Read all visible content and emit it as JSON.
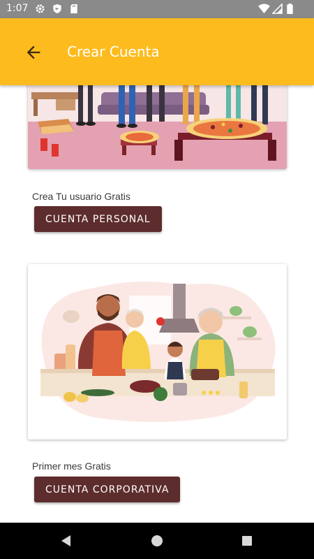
{
  "status_bar": {
    "time": "1:07",
    "icons": [
      "gear-icon",
      "shield-icon",
      "sd-card-icon",
      "wifi-icon",
      "signal-icon",
      "battery-icon"
    ]
  },
  "app_bar": {
    "title": "Crear Cuenta",
    "back_icon": "arrow-back-icon",
    "color": "#fdbb1d"
  },
  "sections": [
    {
      "image": "illustration-pizza-party",
      "caption": "Crea Tu usuario Gratis",
      "button_label": "CUENTA PERSONAL"
    },
    {
      "image": "illustration-family-cooking",
      "caption": "Primer mes Gratis",
      "button_label": "CUENTA CORPORATIVA"
    }
  ],
  "colors": {
    "button": "#5d2c2c",
    "accent": "#fdbb1d"
  },
  "nav_bar": {
    "buttons": [
      "back-triangle-icon",
      "home-circle-icon",
      "recents-square-icon"
    ]
  }
}
